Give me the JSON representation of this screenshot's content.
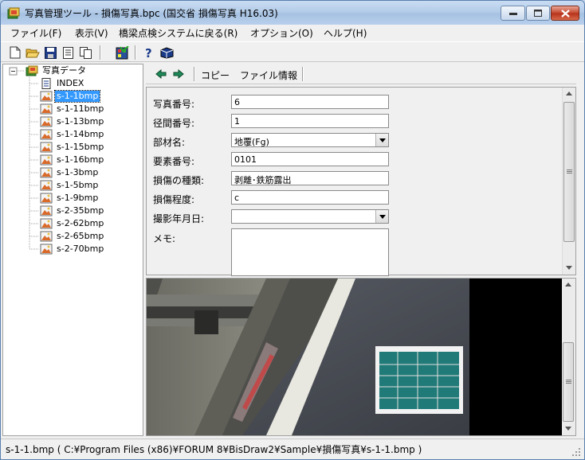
{
  "window": {
    "title": "写真管理ツール - 損傷写真.bpc (国交省 損傷写真 H16.03)"
  },
  "menu": [
    "ファイル(F)",
    "表示(V)",
    "橋梁点検システムに戻る(R)",
    "オプション(O)",
    "ヘルプ(H)"
  ],
  "tree": {
    "root": "写真データ",
    "items": [
      "INDEX",
      "s-1-1bmp",
      "s-1-11bmp",
      "s-1-13bmp",
      "s-1-14bmp",
      "s-1-15bmp",
      "s-1-16bmp",
      "s-1-3bmp",
      "s-1-5bmp",
      "s-1-9bmp",
      "s-2-35bmp",
      "s-2-62bmp",
      "s-2-65bmp",
      "s-2-70bmp"
    ],
    "selected": "s-1-1bmp"
  },
  "right_toolbar": {
    "copy": "コピー",
    "file_info": "ファイル情報"
  },
  "form": {
    "photo_no": {
      "label": "写真番号:",
      "value": "6"
    },
    "span_no": {
      "label": "径間番号:",
      "value": "1"
    },
    "member_name": {
      "label": "部材名:",
      "value": "地覆(Fg)"
    },
    "element_no": {
      "label": "要素番号:",
      "value": "0101"
    },
    "damage_type": {
      "label": "損傷の種類:",
      "value": "剥離･鉄筋露出"
    },
    "damage_level": {
      "label": "損傷程度:",
      "value": "c"
    },
    "shoot_date": {
      "label": "撮影年月日:",
      "value": ""
    },
    "memo": {
      "label": "メモ:",
      "value": ""
    }
  },
  "status": "s-1-1.bmp ( C:¥Program Files (x86)¥FORUM 8¥BisDraw2¥Sample¥損傷写真¥s-1-1.bmp )"
}
